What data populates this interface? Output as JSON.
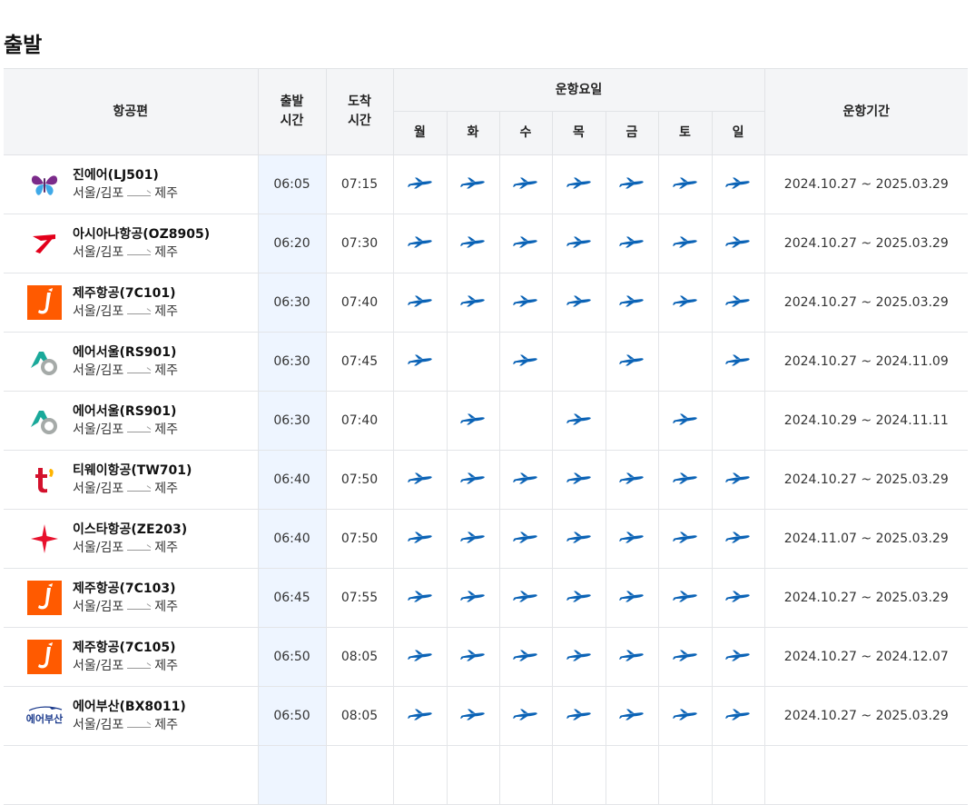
{
  "page": {
    "title": "출발"
  },
  "headers": {
    "flight": "항공편",
    "dep_line1": "출발",
    "dep_line2": "시간",
    "arr_line1": "도착",
    "arr_line2": "시간",
    "days_group": "운항요일",
    "days": [
      "월",
      "화",
      "수",
      "목",
      "금",
      "토",
      "일"
    ],
    "period": "운항기간"
  },
  "colors": {
    "plane": "#0b63b6",
    "dep_column_bg": "#eef5ff",
    "header_bg": "#f4f5f7"
  },
  "icons": {
    "plane": "airplane-icon",
    "route_arrow": "arrow-right-icon"
  },
  "flights": [
    {
      "logo": "jinair-logo",
      "name": "진에어(LJ501)",
      "from": "서울/김포",
      "to": "제주",
      "dep": "06:05",
      "arr": "07:15",
      "days": [
        1,
        1,
        1,
        1,
        1,
        1,
        1
      ],
      "period": "2024.10.27 ~ 2025.03.29"
    },
    {
      "logo": "asiana-logo",
      "name": "아시아나항공(OZ8905)",
      "from": "서울/김포",
      "to": "제주",
      "dep": "06:20",
      "arr": "07:30",
      "days": [
        1,
        1,
        1,
        1,
        1,
        1,
        1
      ],
      "period": "2024.10.27 ~ 2025.03.29"
    },
    {
      "logo": "jejuair-logo",
      "name": "제주항공(7C101)",
      "from": "서울/김포",
      "to": "제주",
      "dep": "06:30",
      "arr": "07:40",
      "days": [
        1,
        1,
        1,
        1,
        1,
        1,
        1
      ],
      "period": "2024.10.27 ~ 2025.03.29"
    },
    {
      "logo": "airseoul-logo",
      "name": "에어서울(RS901)",
      "from": "서울/김포",
      "to": "제주",
      "dep": "06:30",
      "arr": "07:45",
      "days": [
        1,
        0,
        1,
        0,
        1,
        0,
        1
      ],
      "period": "2024.10.27 ~ 2024.11.09"
    },
    {
      "logo": "airseoul-logo",
      "name": "에어서울(RS901)",
      "from": "서울/김포",
      "to": "제주",
      "dep": "06:30",
      "arr": "07:40",
      "days": [
        0,
        1,
        0,
        1,
        0,
        1,
        0
      ],
      "period": "2024.10.29 ~ 2024.11.11"
    },
    {
      "logo": "tway-logo",
      "name": "티웨이항공(TW701)",
      "from": "서울/김포",
      "to": "제주",
      "dep": "06:40",
      "arr": "07:50",
      "days": [
        1,
        1,
        1,
        1,
        1,
        1,
        1
      ],
      "period": "2024.10.27 ~ 2025.03.29"
    },
    {
      "logo": "eastar-logo",
      "name": "이스타항공(ZE203)",
      "from": "서울/김포",
      "to": "제주",
      "dep": "06:40",
      "arr": "07:50",
      "days": [
        1,
        1,
        1,
        1,
        1,
        1,
        1
      ],
      "period": "2024.11.07 ~ 2025.03.29"
    },
    {
      "logo": "jejuair-logo",
      "name": "제주항공(7C103)",
      "from": "서울/김포",
      "to": "제주",
      "dep": "06:45",
      "arr": "07:55",
      "days": [
        1,
        1,
        1,
        1,
        1,
        1,
        1
      ],
      "period": "2024.10.27 ~ 2025.03.29"
    },
    {
      "logo": "jejuair-logo",
      "name": "제주항공(7C105)",
      "from": "서울/김포",
      "to": "제주",
      "dep": "06:50",
      "arr": "08:05",
      "days": [
        1,
        1,
        1,
        1,
        1,
        1,
        1
      ],
      "period": "2024.10.27 ~ 2024.12.07"
    },
    {
      "logo": "airbusan-logo",
      "logo_text": "에어부산",
      "name": "에어부산(BX8011)",
      "from": "서울/김포",
      "to": "제주",
      "dep": "06:50",
      "arr": "08:05",
      "days": [
        1,
        1,
        1,
        1,
        1,
        1,
        1
      ],
      "period": "2024.10.27 ~ 2025.03.29"
    },
    {
      "logo": "",
      "name": "",
      "from": "",
      "to": "",
      "dep": "",
      "arr": "",
      "days": [
        0,
        0,
        0,
        0,
        0,
        0,
        0
      ],
      "period": ""
    }
  ]
}
